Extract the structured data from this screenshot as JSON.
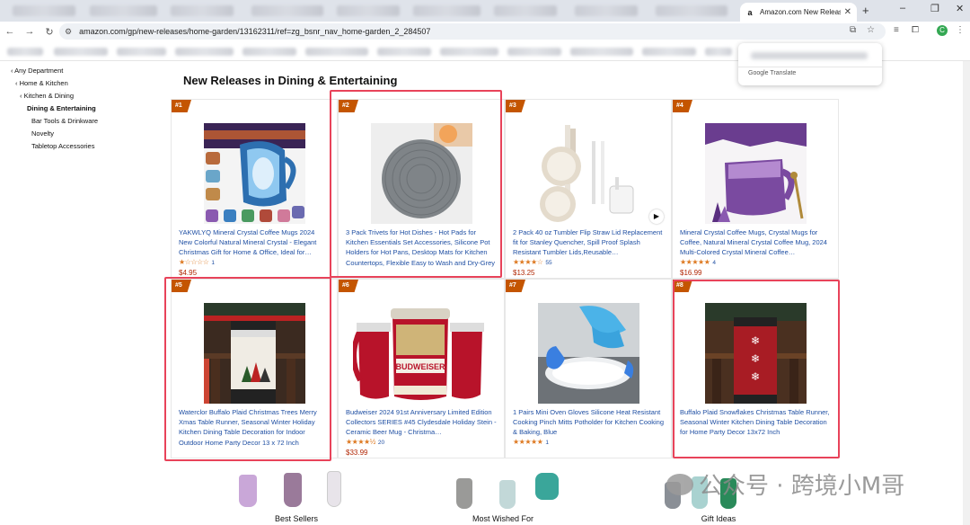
{
  "browser": {
    "active_tab_title": "Amazon.com New Releases",
    "url": "amazon.com/gp/new-releases/home-garden/13162311/ref=zg_bsnr_nav_home-garden_2_284507",
    "translate_popup_label": "Google Translate",
    "profile_initial": "C"
  },
  "sidebar": {
    "items": [
      {
        "label": "‹ Any Department",
        "level": "lvl0"
      },
      {
        "label": "‹ Home & Kitchen",
        "level": "lvl1"
      },
      {
        "label": "‹ Kitchen & Dining",
        "level": "lvl2"
      },
      {
        "label": "Dining & Entertaining",
        "level": "cur"
      },
      {
        "label": "Bar Tools & Drinkware",
        "level": "sub"
      },
      {
        "label": "Novelty",
        "level": "sub"
      },
      {
        "label": "Tabletop Accessories",
        "level": "sub"
      }
    ]
  },
  "page_title": "New Releases in Dining & Entertaining",
  "products": [
    {
      "rank": "#1",
      "title": "YAKWLYQ Mineral Crystal Coffee Mugs 2024 New Colorful Natural Mineral Crystal - Elegant Christmas Gift for Home & Office, Ideal for…",
      "stars": "★☆☆☆☆",
      "rating": 1,
      "reviews": "1",
      "price": "$4.95",
      "image": "crystal-mugs"
    },
    {
      "rank": "#2",
      "title": "3 Pack Trivets for Hot Dishes - Hot Pads for Kitchen Essentials Set Accessories, Silicone Pot Holders for Hot Pans, Desktop Mats for Kitchen Countertops, Flexible Easy to Wash and Dry-Grey",
      "stars": "",
      "rating": 0,
      "reviews": "",
      "price": "",
      "image": "trivets"
    },
    {
      "rank": "#3",
      "title": "2 Pack 40 oz Tumbler Flip Straw Lid Replacement fit for Stanley Quencher, Spill Proof Splash Resistant Tumbler Lids,Reusable…",
      "stars": "★★★★☆",
      "rating": 4,
      "reviews": "55",
      "price": "$13.25",
      "image": "tumbler-lids"
    },
    {
      "rank": "#4",
      "title": "Mineral Crystal Coffee Mugs, Crystal Mugs for Coffee, Natural Mineral Crystal Coffee Mug, 2024 Multi-Colored Crystal Mineral Coffee…",
      "stars": "★★★★★",
      "rating": 5,
      "reviews": "4",
      "price": "$16.99",
      "image": "amethyst-mug"
    },
    {
      "rank": "#5",
      "title": "Waterclor Buffalo Plaid Christmas Trees Merry Xmas Table Runner, Seasonal Winter Holiday Kitchen Dining Table Decoration for Indoor Outdoor Home Party Decor 13 x 72 Inch",
      "stars": "",
      "rating": 0,
      "reviews": "",
      "price": "",
      "image": "plaid-runner"
    },
    {
      "rank": "#6",
      "title": "Budweiser 2024 91st Anniversary Limited Edition Collectors SERIES #45 Clydesdale Holiday Stein - Ceramic Beer Mug - Christma…",
      "stars": "★★★★½",
      "rating": 4.5,
      "reviews": "20",
      "price": "$33.99",
      "image": "budweiser-stein"
    },
    {
      "rank": "#7",
      "title": "1 Pairs Mini Oven Gloves Silicone Heat Resistant Cooking Pinch Mitts Potholder for Kitchen Cooking & Baking, Blue",
      "stars": "★★★★★",
      "rating": 5,
      "reviews": "1",
      "price": "",
      "image": "pinch-mitts"
    },
    {
      "rank": "#8",
      "title": "Buffalo Plaid Snowflakes Christmas Table Runner, Seasonal Winter Kitchen Dining Table Decoration for Home Party Decor 13x72 Inch",
      "stars": "",
      "rating": 0,
      "reviews": "",
      "price": "",
      "image": "snowflake-runner"
    }
  ],
  "bottom_sections": [
    {
      "label": "Best Sellers"
    },
    {
      "label": "Most Wished For"
    },
    {
      "label": "Gift Ideas"
    }
  ],
  "watermark": "公众号 · 跨境小M哥",
  "colors": {
    "rank_badge": "#c45500",
    "link": "#1f4fa3",
    "price": "#b12704",
    "star": "#de7921",
    "highlight": "#e8435a"
  }
}
